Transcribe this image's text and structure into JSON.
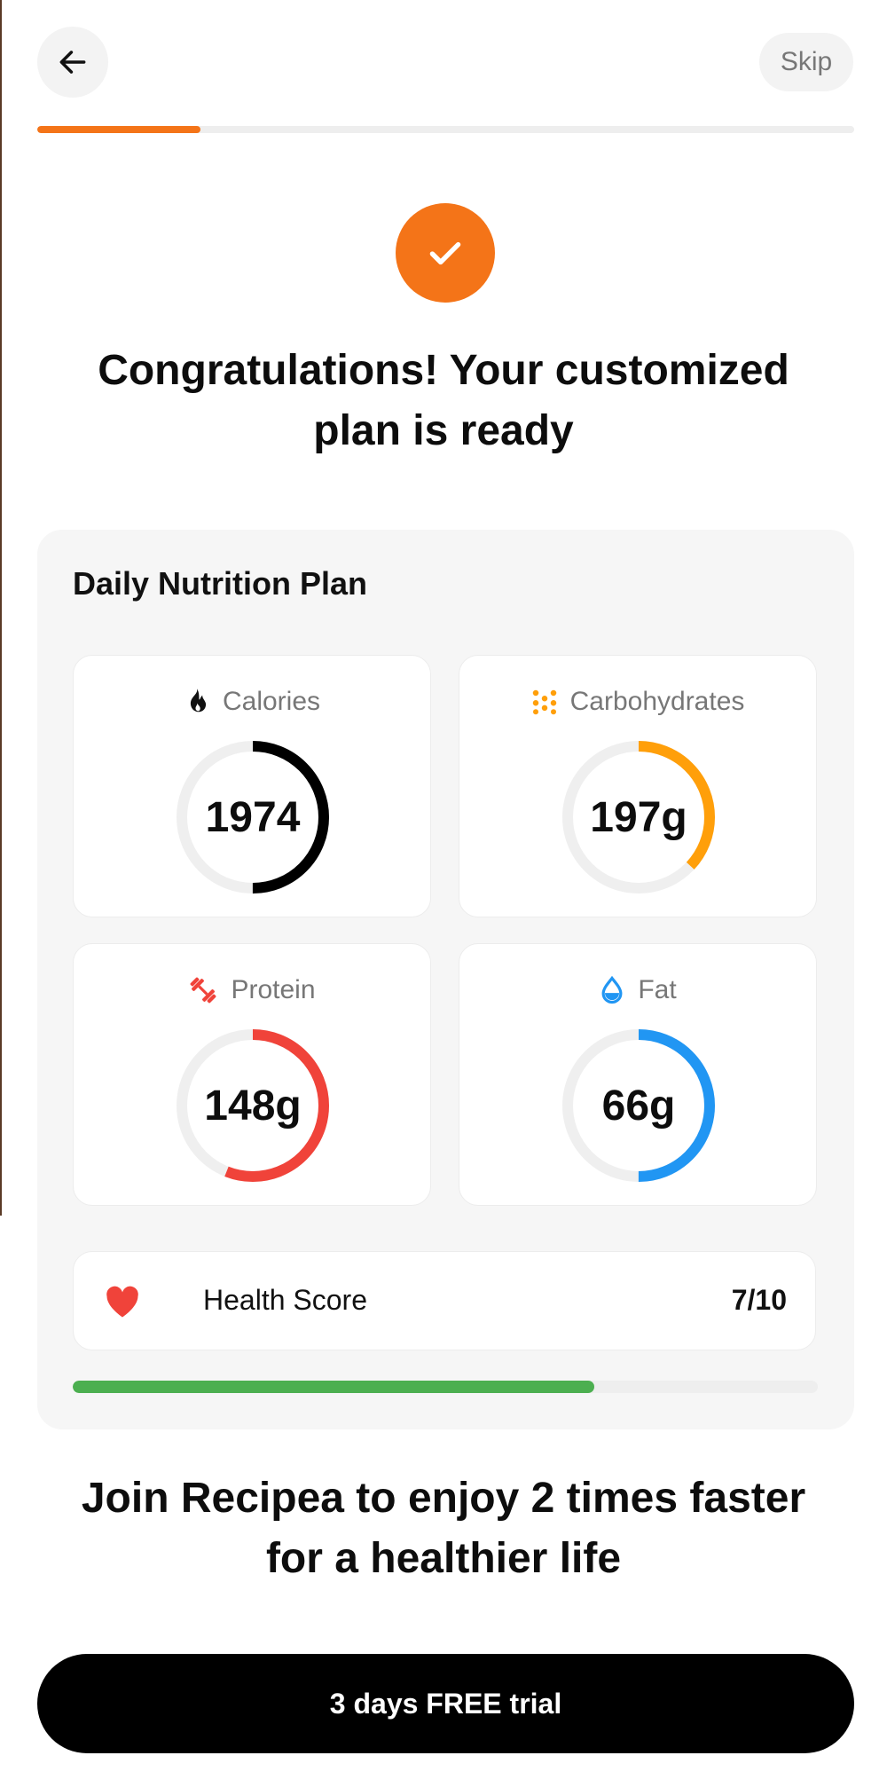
{
  "header": {
    "back_icon": "arrow-left-icon",
    "skip_label": "Skip",
    "progress_fraction": 0.2,
    "progress_color": "#F47418"
  },
  "hero": {
    "check_icon": "checkmark-icon",
    "accent_color": "#F47418",
    "headline_line1": "Congratulations! Your customized",
    "headline_line2": "plan is ready"
  },
  "plan": {
    "title": "Daily Nutrition Plan",
    "macros": [
      {
        "label": "Calories",
        "value": "1974",
        "icon": "flame-icon",
        "color": "#000000",
        "ring_fraction": 0.5
      },
      {
        "label": "Carbohydrates",
        "value": "197g",
        "icon": "grain-dots-icon",
        "color": "#FF9F0A",
        "ring_fraction": 0.37
      },
      {
        "label": "Protein",
        "value": "148g",
        "icon": "dumbbell-icon",
        "color": "#F0433A",
        "ring_fraction": 0.56
      },
      {
        "label": "Fat",
        "value": "66g",
        "icon": "water-drop-icon",
        "color": "#2196F3",
        "ring_fraction": 0.5
      }
    ],
    "health_score": {
      "icon": "heart-icon",
      "label": "Health Score",
      "value": "7/10",
      "fraction": 0.7,
      "color": "#4CAF50"
    }
  },
  "tagline": {
    "line1": "Join Recipea to enjoy 2 times faster",
    "line2": "for a healthier life"
  },
  "cta": {
    "label": "3 days FREE trial"
  }
}
